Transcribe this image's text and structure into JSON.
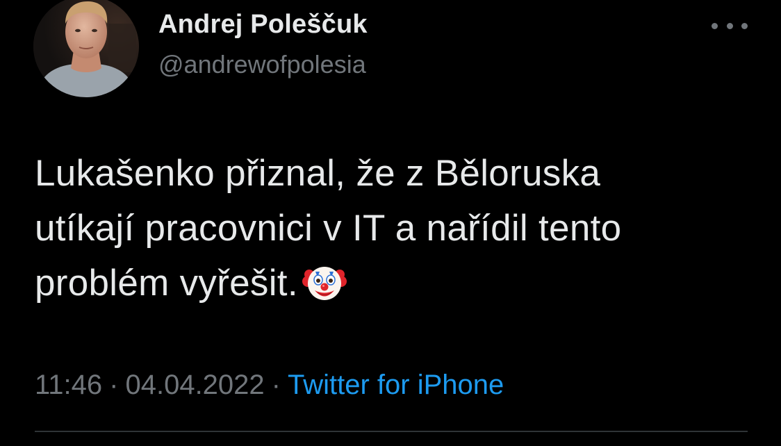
{
  "tweet": {
    "author": {
      "display_name": "Andrej Poleščuk",
      "handle": "@andrewofpolesia",
      "avatar_icon": "user-photo"
    },
    "text_lines": [
      "Lukašenko přiznal, že z Běloruska",
      "utíkají pracovnici v IT a nařídil tento",
      "problém vyřešit."
    ],
    "emoji": "clown-face",
    "time": "11:46",
    "separator": "·",
    "date": "04.04.2022",
    "source": "Twitter for iPhone"
  },
  "colors": {
    "background": "#000000",
    "text_primary": "#e7e9ea",
    "text_secondary": "#71767b",
    "link": "#1d9bf0",
    "divider": "#2f3336"
  }
}
